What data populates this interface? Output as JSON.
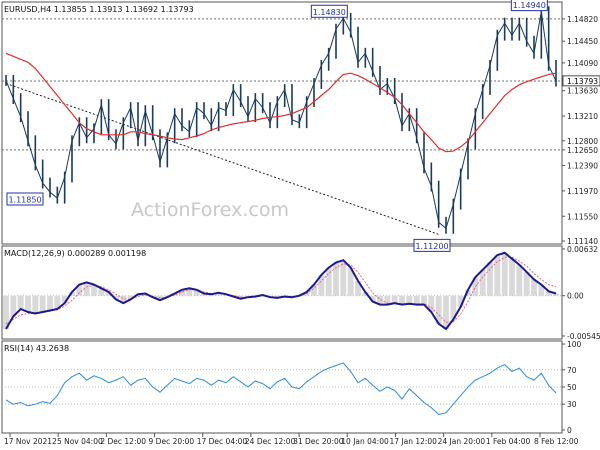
{
  "chart_data": [
    {
      "type": "line",
      "panel": "price",
      "title": "EURUSD,H4",
      "ohlc": [
        "1.13855",
        "1.13913",
        "1.13692",
        "1.13793"
      ],
      "current_price": "1.13793",
      "ylim": [
        1.1114,
        1.1505
      ],
      "y_ticks": [
        "1.14820",
        "1.14450",
        "1.14090",
        "1.13630",
        "1.13210",
        "1.12800",
        "1.12650",
        "1.12390",
        "1.11970",
        "1.11550",
        "1.11140"
      ],
      "x_ticks": [
        "17 Nov 2021",
        "25 Nov 04:00",
        "2 Dec 12:00",
        "9 Dec 20:00",
        "17 Dec 04:00",
        "24 Dec 12:00",
        "31 Dec 20:00",
        "10 Jan 04:00",
        "17 Jan 12:00",
        "24 Jan 20:00",
        "1 Feb 04:00",
        "8 Feb 12:00"
      ],
      "annotations": [
        {
          "label": "1.14830",
          "value": 1.1483
        },
        {
          "label": "1.14940",
          "value": 1.1494
        },
        {
          "label": "1.11850",
          "value": 1.1185
        },
        {
          "label": "1.11200",
          "value": 1.112
        }
      ],
      "horizontal_levels": [
        1.1482,
        1.1379,
        1.1265
      ],
      "price_series": [
        1.138,
        1.135,
        1.132,
        1.128,
        1.124,
        1.121,
        1.1195,
        1.1185,
        1.122,
        1.128,
        1.131,
        1.1285,
        1.13,
        1.134,
        1.129,
        1.1275,
        1.131,
        1.1335,
        1.128,
        1.133,
        1.129,
        1.1245,
        1.1285,
        1.1325,
        1.1305,
        1.1295,
        1.1335,
        1.1325,
        1.1305,
        1.1335,
        1.133,
        1.1365,
        1.1345,
        1.132,
        1.135,
        1.1335,
        1.131,
        1.1345,
        1.1365,
        1.1315,
        1.131,
        1.1345,
        1.1375,
        1.1405,
        1.1425,
        1.1465,
        1.1483,
        1.146,
        1.141,
        1.1425,
        1.1395,
        1.1365,
        1.1375,
        1.135,
        1.1305,
        1.1325,
        1.1285,
        1.1235,
        1.1205,
        1.1145,
        1.1135,
        1.1175,
        1.1225,
        1.1275,
        1.1325,
        1.1365,
        1.1405,
        1.1455,
        1.1475,
        1.1455,
        1.1475,
        1.1445,
        1.1425,
        1.1494,
        1.1405,
        1.1379
      ],
      "ma_series": [
        1.1425,
        1.142,
        1.1415,
        1.141,
        1.14,
        1.1385,
        1.137,
        1.1355,
        1.134,
        1.1325,
        1.131,
        1.13,
        1.1295,
        1.129,
        1.129,
        1.129,
        1.129,
        1.1295,
        1.1295,
        1.1292,
        1.129,
        1.1288,
        1.1285,
        1.1283,
        1.1282,
        1.1285,
        1.1288,
        1.1292,
        1.1298,
        1.1302,
        1.1305,
        1.1308,
        1.131,
        1.1312,
        1.1314,
        1.1317,
        1.1319,
        1.132,
        1.1322,
        1.1325,
        1.133,
        1.1335,
        1.1345,
        1.1355,
        1.1365,
        1.1378,
        1.139,
        1.1392,
        1.1388,
        1.1382,
        1.1375,
        1.1368,
        1.136,
        1.1352,
        1.134,
        1.1325,
        1.131,
        1.1295,
        1.1282,
        1.1268,
        1.1262,
        1.1263,
        1.127,
        1.128,
        1.1295,
        1.131,
        1.1325,
        1.134,
        1.1355,
        1.1365,
        1.1373,
        1.1378,
        1.1382,
        1.1386,
        1.139,
        1.1392
      ],
      "trendline": {
        "from": [
          0,
          1.1375
        ],
        "to": [
          59,
          1.1125
        ]
      },
      "watermark": "ActionForex.com"
    },
    {
      "type": "line",
      "panel": "macd",
      "title": "MACD(12,26,9) 0.000289 0.001198",
      "ylim": [
        -0.00545,
        0.00632
      ],
      "y_ticks": [
        "0.00632",
        "0.00",
        "-0.005455"
      ],
      "macd_series": [
        -0.0045,
        -0.0028,
        -0.0018,
        -0.0022,
        -0.0024,
        -0.0022,
        -0.002,
        -0.0018,
        -0.001,
        0.0005,
        0.0015,
        0.0018,
        0.0015,
        0.001,
        0.0005,
        -0.0005,
        -0.001,
        -0.0005,
        0.0002,
        0.0003,
        -0.0002,
        -0.0006,
        -0.0002,
        0.0003,
        0.0008,
        0.001,
        0.0008,
        0.0003,
        0.0002,
        0.0004,
        0.0002,
        -0.0001,
        -0.0004,
        -0.0002,
        -0.0001,
        0.0001,
        -0.0002,
        -0.0003,
        -0.0001,
        -0.0002,
        0.0,
        0.0005,
        0.0015,
        0.0028,
        0.0038,
        0.0045,
        0.0048,
        0.0038,
        0.002,
        0.0005,
        -0.0008,
        -0.0012,
        -0.0012,
        -0.001,
        -0.0012,
        -0.0011,
        -0.0012,
        -0.0012,
        -0.0022,
        -0.0038,
        -0.0045,
        -0.0032,
        -0.0015,
        0.0008,
        0.0025,
        0.0035,
        0.0045,
        0.0055,
        0.0058,
        0.005,
        0.0042,
        0.0032,
        0.0022,
        0.0015,
        0.0006,
        0.0003
      ],
      "signal_series": [
        -0.0038,
        -0.0032,
        -0.0026,
        -0.0024,
        -0.0023,
        -0.0022,
        -0.0021,
        -0.0019,
        -0.0014,
        -0.0006,
        0.0004,
        0.0012,
        0.0014,
        0.0012,
        0.0008,
        0.0002,
        -0.0004,
        -0.0005,
        -0.0001,
        0.0001,
        -0.0001,
        -0.0003,
        -0.0002,
        0.0001,
        0.0005,
        0.0008,
        0.0008,
        0.0005,
        0.0003,
        0.0003,
        0.0002,
        0.0,
        -0.0002,
        -0.0002,
        -0.0002,
        0.0,
        -0.0001,
        -0.0002,
        -0.0002,
        -0.0002,
        -0.0001,
        0.0003,
        0.001,
        0.002,
        0.003,
        0.0038,
        0.0043,
        0.0042,
        0.0032,
        0.0018,
        0.0004,
        -0.0005,
        -0.001,
        -0.001,
        -0.0011,
        -0.0011,
        -0.0011,
        -0.0011,
        -0.0016,
        -0.0026,
        -0.0036,
        -0.0035,
        -0.0025,
        -0.0008,
        0.0012,
        0.0025,
        0.0036,
        0.0046,
        0.0052,
        0.0052,
        0.0047,
        0.004,
        0.003,
        0.0022,
        0.0015,
        0.0012
      ]
    },
    {
      "type": "line",
      "panel": "rsi",
      "title": "RSI(14) 43.2638",
      "ylim": [
        0,
        100
      ],
      "y_ticks": [
        "100",
        "70",
        "50",
        "30",
        "0"
      ],
      "rsi_series": [
        35,
        30,
        32,
        28,
        30,
        33,
        31,
        40,
        55,
        62,
        66,
        58,
        63,
        60,
        55,
        58,
        62,
        52,
        58,
        60,
        50,
        44,
        52,
        60,
        57,
        54,
        60,
        58,
        52,
        58,
        55,
        62,
        56,
        50,
        57,
        54,
        48,
        56,
        60,
        50,
        48,
        56,
        62,
        68,
        72,
        75,
        78,
        68,
        55,
        60,
        52,
        45,
        50,
        46,
        36,
        48,
        40,
        32,
        26,
        18,
        20,
        30,
        40,
        50,
        58,
        62,
        66,
        72,
        76,
        68,
        72,
        62,
        58,
        66,
        52,
        43
      ]
    }
  ]
}
